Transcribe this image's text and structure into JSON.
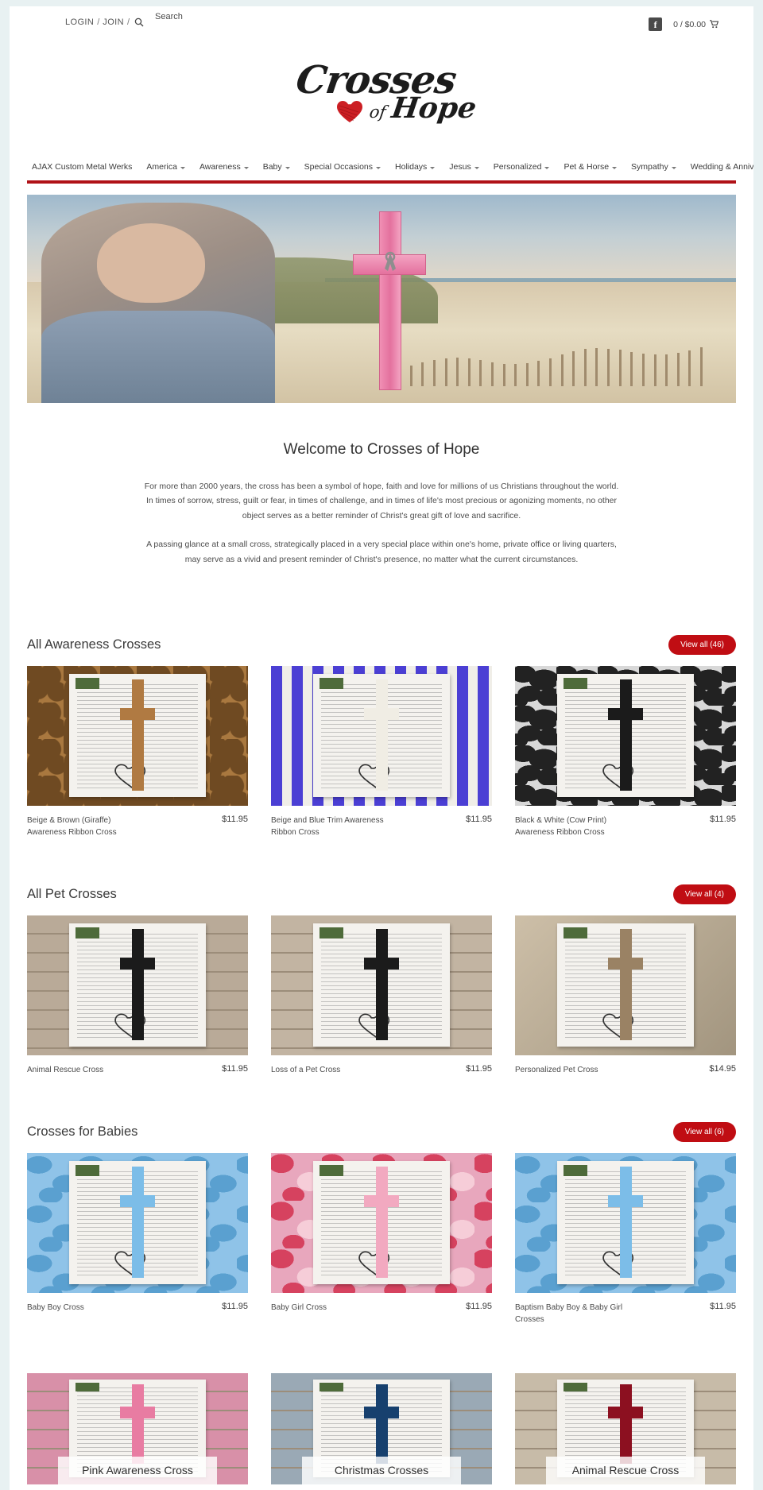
{
  "topbar": {
    "login": "LOGIN",
    "join": "JOIN",
    "separator": "/",
    "search_icon": "search-icon",
    "search_label": "Search",
    "facebook_label": "f",
    "cart_text": "0 / $0.00",
    "cart_icon": "shopping-cart-icon"
  },
  "logo": {
    "line1": "Crosses",
    "line2": "of",
    "line3": "Hope"
  },
  "nav": {
    "items": [
      {
        "label": "AJAX Custom Metal Werks",
        "has_dropdown": false
      },
      {
        "label": "America",
        "has_dropdown": true
      },
      {
        "label": "Awareness",
        "has_dropdown": true
      },
      {
        "label": "Baby",
        "has_dropdown": true
      },
      {
        "label": "Special Occasions",
        "has_dropdown": true
      },
      {
        "label": "Holidays",
        "has_dropdown": true
      },
      {
        "label": "Jesus",
        "has_dropdown": true
      },
      {
        "label": "Personalized",
        "has_dropdown": true
      },
      {
        "label": "Pet & Horse",
        "has_dropdown": true
      },
      {
        "label": "Sympathy",
        "has_dropdown": true
      },
      {
        "label": "Wedding & Anniversary",
        "has_dropdown": true
      }
    ]
  },
  "hero": {
    "alt": "Woman on beach beside a pink awareness ribbon cross"
  },
  "welcome": {
    "heading": "Welcome to Crosses of Hope",
    "paragraph1": "For more than 2000 years, the cross has been a symbol of hope, faith and love for millions of us Christians throughout the world. In times of sorrow, stress, guilt or fear, in times of challenge, and in times of life's most precious or agonizing moments, no other object serves as a better reminder of Christ's great gift of love and sacrifice.",
    "paragraph2": "A passing glance at a small cross, strategically placed in a very special place within one's home, private office or living quarters, may serve as a vivid and present reminder of Christ's presence, no matter what the current circumstances."
  },
  "sections": [
    {
      "title": "All Awareness Crosses",
      "view_all": "View all (46)",
      "products": [
        {
          "name": "Beige & Brown (Giraffe) Awareness Ribbon Cross",
          "price": "$11.95",
          "bg": "#a9783f",
          "pattern": "giraffe",
          "cross": "#b07a42"
        },
        {
          "name": "Beige and Blue Trim Awareness Ribbon Cross",
          "price": "$11.95",
          "bg": "#4b3fd4",
          "pattern": "stripes",
          "cross": "#f0ede4"
        },
        {
          "name": "Black & White (Cow Print) Awareness Ribbon Cross",
          "price": "$11.95",
          "bg": "#d8d8d8",
          "pattern": "cow",
          "cross": "#1b1b1b"
        }
      ]
    },
    {
      "title": "All Pet Crosses",
      "view_all": "View all (4)",
      "products": [
        {
          "name": "Animal Rescue Cross",
          "price": "$11.95",
          "bg": "#b9aa98",
          "pattern": "wood",
          "cross": "#1b1b1b"
        },
        {
          "name": "Loss of a Pet Cross",
          "price": "$11.95",
          "bg": "#c2b4a2",
          "pattern": "wood",
          "cross": "#1b1b1b"
        },
        {
          "name": "Personalized Pet Cross",
          "price": "$14.95",
          "bg": "#c6b9a6",
          "pattern": "photo",
          "cross": "#9a8264"
        }
      ]
    },
    {
      "title": "Crosses for Babies",
      "view_all": "View all (6)",
      "products": [
        {
          "name": "Baby Boy Cross",
          "price": "$11.95",
          "bg": "#8fc3e8",
          "pattern": "whales",
          "cross": "#7cbde8"
        },
        {
          "name": "Baby Girl Cross",
          "price": "$11.95",
          "bg": "#e8a7bd",
          "pattern": "elephants",
          "cross": "#f2a9c0"
        },
        {
          "name": "Baptism Baby Boy & Baby Girl Crosses",
          "price": "$11.95",
          "bg": "#8fc3e8",
          "pattern": "whales",
          "cross": "#7cbde8"
        }
      ]
    }
  ],
  "categories": [
    {
      "label": "Pink Awareness Cross",
      "bg": "#d890a8",
      "cross": "#e87ca2"
    },
    {
      "label": "Christmas Crosses",
      "bg": "#9aa9b5",
      "cross": "#17406e"
    },
    {
      "label": "Animal Rescue Cross",
      "bg": "#c7bba8",
      "cross": "#8c1020"
    }
  ],
  "colors": {
    "accent_red": "#c00d13",
    "nav_underline": "#b01117",
    "page_bg": "#e8f1f2",
    "text": "#4a4a4a"
  }
}
